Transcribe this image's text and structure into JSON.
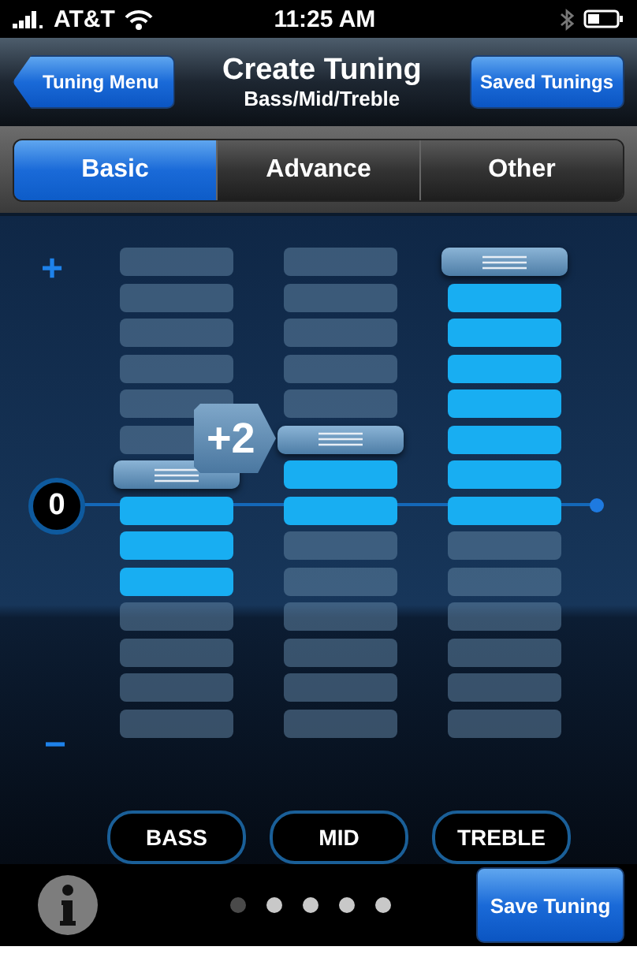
{
  "status_bar": {
    "carrier": "AT&T",
    "time": "11:25 AM"
  },
  "nav": {
    "back": "Tuning Menu",
    "title": "Create Tuning",
    "subtitle": "Bass/Mid/Treble",
    "action": "Saved Tunings"
  },
  "tabs": [
    {
      "label": "Basic",
      "selected": true
    },
    {
      "label": "Advance",
      "selected": false
    },
    {
      "label": "Other",
      "selected": false
    }
  ],
  "scale": {
    "top": "+",
    "zero": "0",
    "bottom": "−"
  },
  "badge": "+2",
  "bands": [
    {
      "label": "BASS",
      "segments": [
        {
          "kind": "off"
        },
        {
          "kind": "off"
        },
        {
          "kind": "off"
        },
        {
          "kind": "off"
        },
        {
          "kind": "off"
        },
        {
          "kind": "off"
        },
        {
          "kind": "handle"
        },
        {
          "kind": "lit"
        },
        {
          "kind": "lit"
        },
        {
          "kind": "lit"
        },
        {
          "kind": "off"
        },
        {
          "kind": "off"
        },
        {
          "kind": "off"
        },
        {
          "kind": "off"
        }
      ]
    },
    {
      "label": "MID",
      "segments": [
        {
          "kind": "off"
        },
        {
          "kind": "off"
        },
        {
          "kind": "off"
        },
        {
          "kind": "off"
        },
        {
          "kind": "off"
        },
        {
          "kind": "handle"
        },
        {
          "kind": "lit"
        },
        {
          "kind": "lit"
        },
        {
          "kind": "off"
        },
        {
          "kind": "off"
        },
        {
          "kind": "off"
        },
        {
          "kind": "off"
        },
        {
          "kind": "off"
        },
        {
          "kind": "off"
        }
      ]
    },
    {
      "label": "TREBLE",
      "segments": [
        {
          "kind": "handle"
        },
        {
          "kind": "lit"
        },
        {
          "kind": "lit"
        },
        {
          "kind": "lit"
        },
        {
          "kind": "lit"
        },
        {
          "kind": "lit"
        },
        {
          "kind": "lit"
        },
        {
          "kind": "lit"
        },
        {
          "kind": "off"
        },
        {
          "kind": "off"
        },
        {
          "kind": "off"
        },
        {
          "kind": "off"
        },
        {
          "kind": "off"
        },
        {
          "kind": "off"
        }
      ]
    }
  ],
  "pages": [
    {
      "selected": true
    },
    {
      "selected": false
    },
    {
      "selected": false
    },
    {
      "selected": false
    },
    {
      "selected": false
    }
  ],
  "save_button": "Save Tuning"
}
